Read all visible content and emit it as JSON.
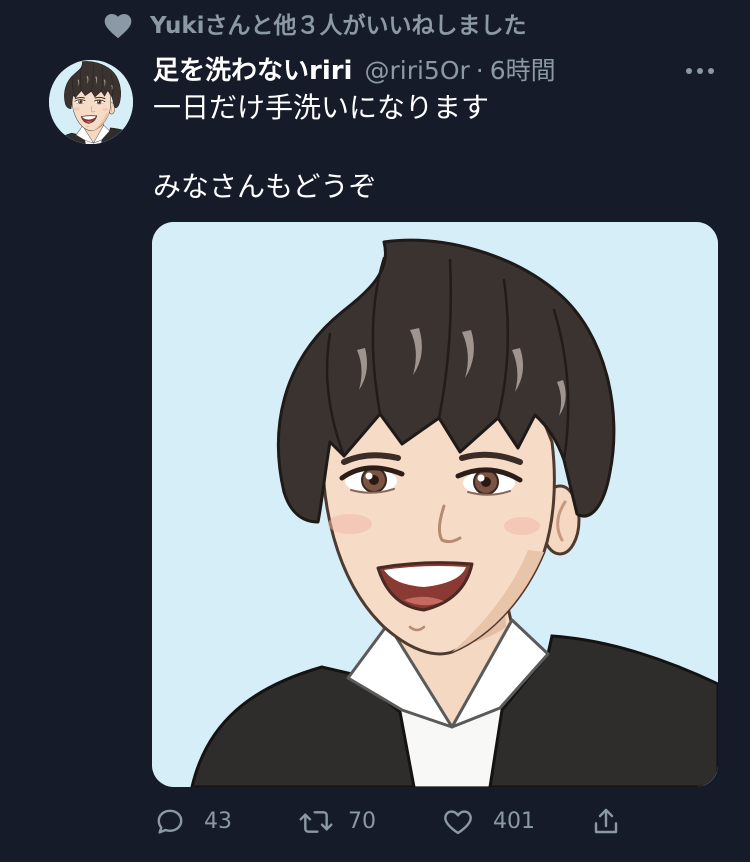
{
  "colors": {
    "background": "#161b2a",
    "text_primary": "#ffffff",
    "text_secondary": "#8b98a5",
    "media_background": "#d6eef8"
  },
  "social_context": {
    "icon": "heart-filled-icon",
    "text": "Yukiさんと他３人がいいねしました"
  },
  "tweet": {
    "author": {
      "name": "足を洗わないriri",
      "handle": "@riri5Or",
      "separator": "·",
      "time": "6時間"
    },
    "more_icon": "more-horizontal-icon",
    "text_lines": [
      "一日だけ手洗いになります",
      "みなさんもどうぞ"
    ],
    "actions": {
      "reply": {
        "icon": "reply-icon",
        "count": "43"
      },
      "retweet": {
        "icon": "retweet-icon",
        "count": "70"
      },
      "like": {
        "icon": "heart-outline-icon",
        "count": "401"
      },
      "share": {
        "icon": "share-icon"
      }
    }
  }
}
